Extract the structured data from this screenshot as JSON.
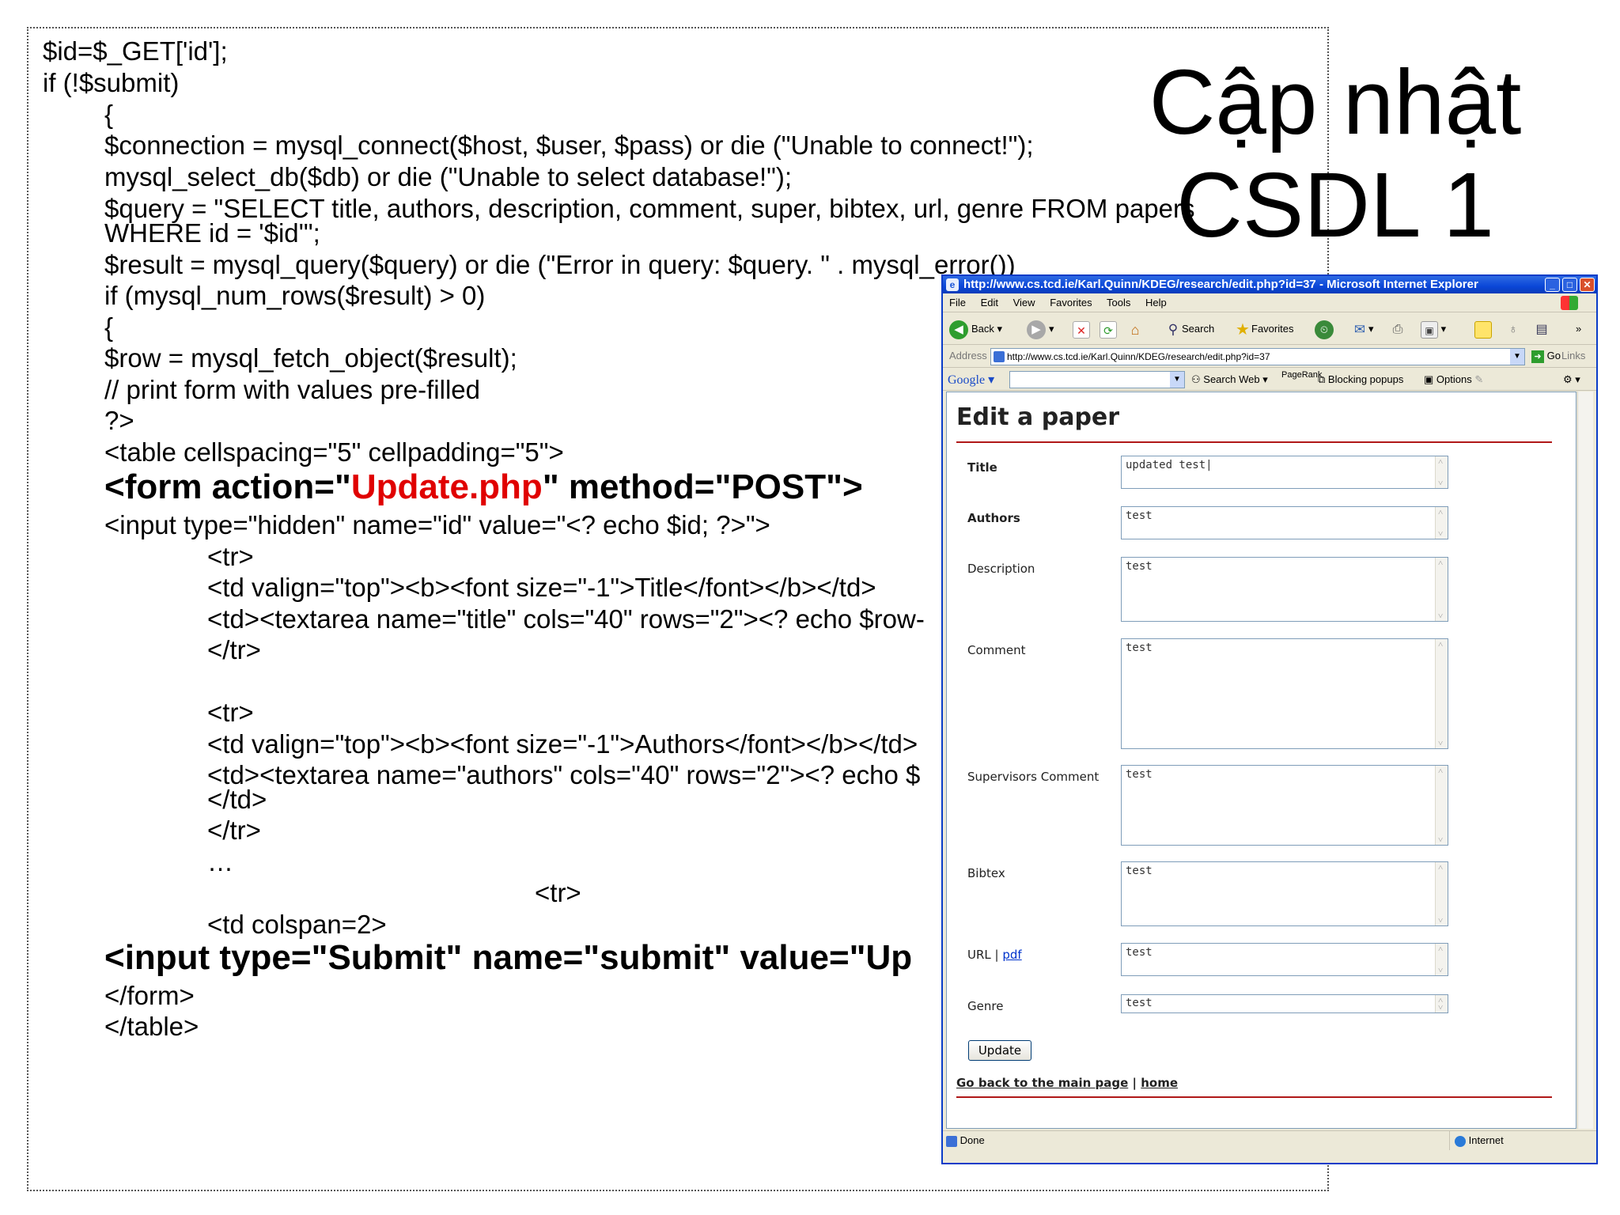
{
  "slide": {
    "title_line1": "Cập nhật",
    "title_line2": "CSDL 1",
    "code_lines": [
      "$id=$_GET['id'];",
      "if (!$submit)",
      "{",
      "$connection = mysql_connect($host, $user, $pass) or die (\"Unable to connect!\");",
      "mysql_select_db($db) or die (\"Unable to select database!\");",
      "$query = \"SELECT title, authors, description, comment, super, bibtex, url, genre FROM papers",
      "WHERE id = '$id'\";",
      "$result = mysql_query($query) or die (\"Error in query: $query. \" . mysql_error())",
      "if (mysql_num_rows($result) > 0)",
      "{",
      "$row = mysql_fetch_object($result);",
      "// print form with values pre-filled",
      "?>",
      "<table cellspacing=\"5\" cellpadding=\"5\">",
      "<form action=\"",
      "Update.php",
      "\"  method=\"POST\">",
      "<input type=\"hidden\" name=\"id\"  value=\"<? echo $id; ?>\">",
      "<tr>",
      "<td valign=\"top\"><b><font size=\"-1\">Title</font></b></td>",
      "<td><textarea name=\"title\" cols=\"40\" rows=\"2\"><? echo $row-",
      "</tr>",
      "<tr>",
      "<td valign=\"top\"><b><font size=\"-1\">Authors</font></b></td>",
      "<td><textarea name=\"authors\" cols=\"40\" rows=\"2\"><? echo $",
      "</td>",
      "</tr>",
      "…",
      "<tr>",
      "<td colspan=2>",
      "<input type=\"Submit\" name=\"submit\" value=\"Up",
      "</form>",
      "</table>"
    ]
  },
  "browser": {
    "title": "http://www.cs.tcd.ie/Karl.Quinn/KDEG/research/edit.php?id=37 - Microsoft Internet Explorer",
    "menu": [
      "File",
      "Edit",
      "View",
      "Favorites",
      "Tools",
      "Help"
    ],
    "toolbar": {
      "back": "Back",
      "search": "Search",
      "favorites": "Favorites"
    },
    "address_label": "Address",
    "address_value": "http://www.cs.tcd.ie/Karl.Quinn/KDEG/research/edit.php?id=37",
    "go": "Go",
    "links": "Links",
    "google": {
      "logo": "Google",
      "search_web": "Search Web",
      "pagerank": "PageRank",
      "blocking": "Blocking popups",
      "options": "Options"
    },
    "status": {
      "left": "Done",
      "right": "Internet"
    }
  },
  "page": {
    "heading": "Edit a paper",
    "fields": [
      {
        "label": "Title",
        "value": "updated test"
      },
      {
        "label": "Authors",
        "value": "test"
      },
      {
        "label": "Description",
        "value": "test"
      },
      {
        "label": "Comment",
        "value": "test"
      },
      {
        "label": "Supervisors Comment",
        "value": "test"
      },
      {
        "label": "Bibtex",
        "value": "test"
      },
      {
        "label": "URL",
        "value": "test"
      },
      {
        "label": "Genre",
        "value": "test"
      }
    ],
    "url_sep": "|",
    "url_pdf_link": "pdf",
    "update_button": "Update",
    "footer_back": "Go back to the main page",
    "footer_sep": "|",
    "footer_home": "home"
  }
}
